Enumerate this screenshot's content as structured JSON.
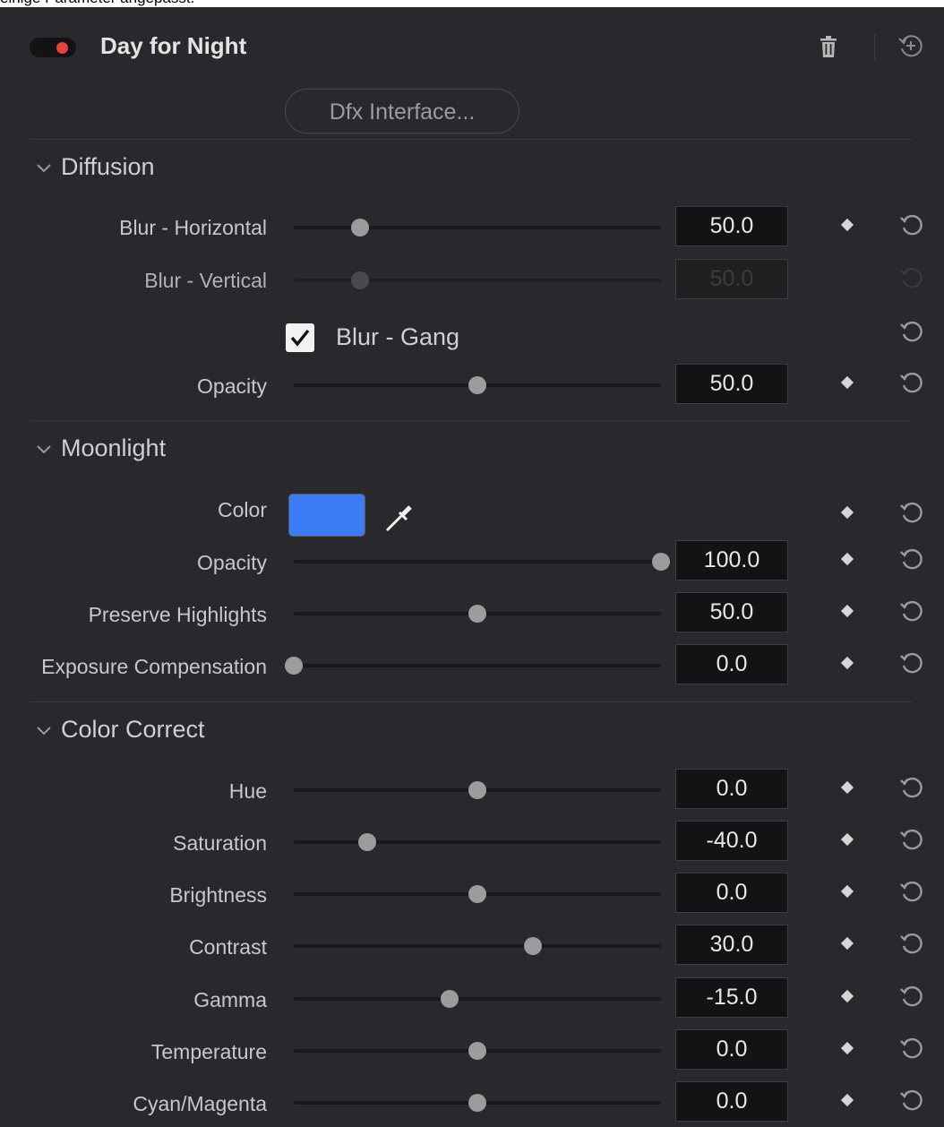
{
  "caption": "einige Parameter angepasst.",
  "effect": {
    "title": "Day for Night",
    "enabled": true,
    "dfx_button_label": "Dfx Interface..."
  },
  "sections": {
    "diffusion": {
      "title": "Diffusion",
      "blur_horizontal": {
        "label": "Blur - Horizontal",
        "value": "50.0",
        "fraction": 0.18
      },
      "blur_vertical": {
        "label": "Blur - Vertical",
        "value": "50.0",
        "fraction": 0.18,
        "disabled": true
      },
      "blur_gang": {
        "label": "Blur - Gang",
        "checked": true
      },
      "opacity": {
        "label": "Opacity",
        "value": "50.0",
        "fraction": 0.5
      }
    },
    "moonlight": {
      "title": "Moonlight",
      "color": {
        "label": "Color",
        "swatch": "#3b7cf5"
      },
      "opacity": {
        "label": "Opacity",
        "value": "100.0",
        "fraction": 1.0
      },
      "preserve_highlights": {
        "label": "Preserve Highlights",
        "value": "50.0",
        "fraction": 0.5
      },
      "exposure_compensation": {
        "label": "Exposure Compensation",
        "value": "0.0",
        "fraction": 0.0
      }
    },
    "color_correct": {
      "title": "Color Correct",
      "hue": {
        "label": "Hue",
        "value": "0.0",
        "fraction": 0.5
      },
      "saturation": {
        "label": "Saturation",
        "value": "-40.0",
        "fraction": 0.2
      },
      "brightness": {
        "label": "Brightness",
        "value": "0.0",
        "fraction": 0.5
      },
      "contrast": {
        "label": "Contrast",
        "value": "30.0",
        "fraction": 0.65
      },
      "gamma": {
        "label": "Gamma",
        "value": "-15.0",
        "fraction": 0.425
      },
      "temperature": {
        "label": "Temperature",
        "value": "0.0",
        "fraction": 0.5
      },
      "cyan_magenta": {
        "label": "Cyan/Magenta",
        "value": "0.0",
        "fraction": 0.5
      }
    }
  },
  "colors": {
    "panel_bg": "#28282d",
    "enabled_dot": "#e8423b",
    "slider_thumb": "#9c9c9c"
  },
  "icons": [
    "chevron-down-icon",
    "trash-icon",
    "reset-icon",
    "keyframe-diamond-icon",
    "eyedropper-icon",
    "checkmark-icon"
  ]
}
